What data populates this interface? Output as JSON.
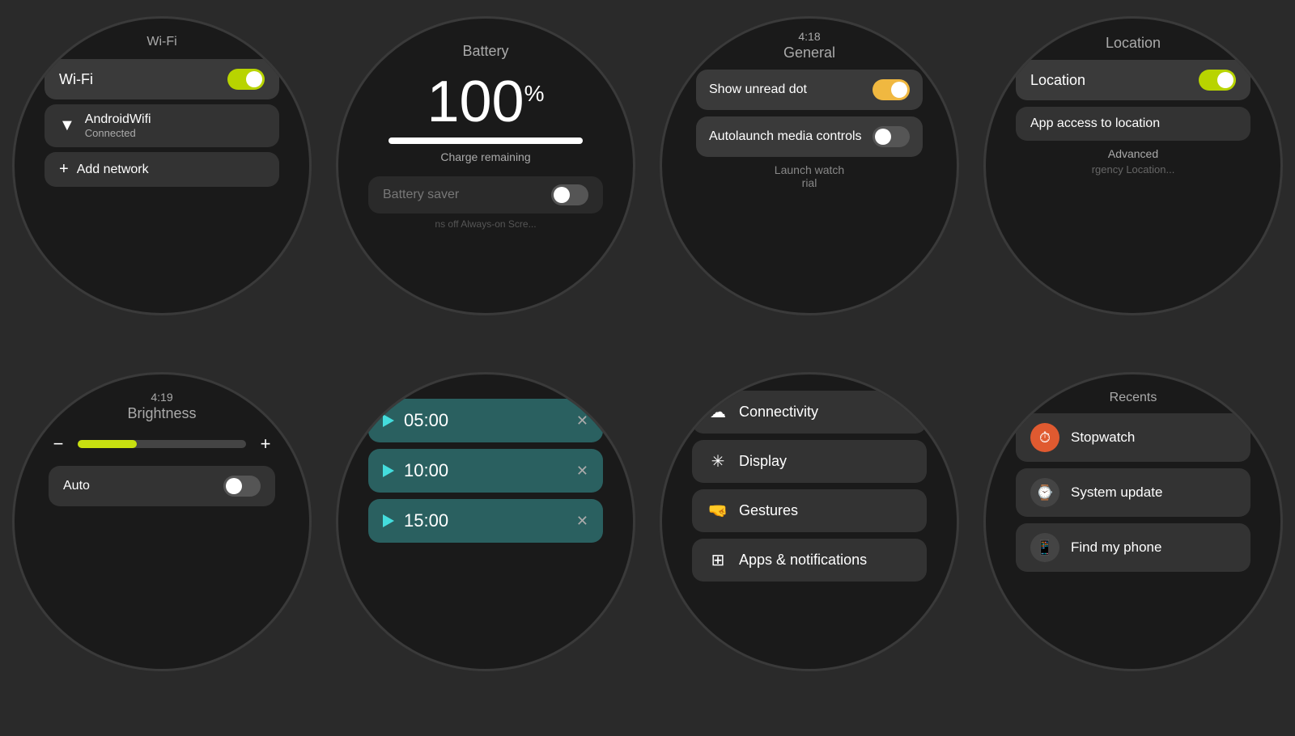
{
  "wifi": {
    "title": "Wi-Fi",
    "toggle_label": "Wi-Fi",
    "toggle_state": "on",
    "network_name": "AndroidWifi",
    "network_status": "Connected",
    "add_network": "Add network"
  },
  "battery": {
    "title": "Battery",
    "percent": "100",
    "percent_symbol": "%",
    "charge_text": "Charge remaining",
    "saver_label": "Battery saver",
    "always_on_text": "ns off Always-on Scre..."
  },
  "general": {
    "time": "4:18",
    "title": "General",
    "show_unread": "Show unread dot",
    "autolaunch": "Autolaunch media controls",
    "launch_watch": "Launch watch",
    "trial": "rial"
  },
  "location": {
    "title": "Location",
    "toggle_label": "Location",
    "app_access": "App access to location",
    "advanced": "Advanced",
    "emergency": "rgency Location..."
  },
  "brightness": {
    "time": "4:19",
    "title": "Brightness",
    "auto_label": "Auto",
    "fill_percent": 35
  },
  "timers": {
    "items": [
      {
        "time": "05:00"
      },
      {
        "time": "10:00"
      },
      {
        "time": "15:00"
      }
    ]
  },
  "settings": {
    "items": [
      {
        "icon": "cloud",
        "label": "Connectivity"
      },
      {
        "icon": "sun",
        "label": "Display"
      },
      {
        "icon": "gesture",
        "label": "Gestures"
      },
      {
        "icon": "apps",
        "label": "Apps & notifications"
      }
    ]
  },
  "recents": {
    "title": "Recents",
    "items": [
      {
        "label": "Stopwatch",
        "icon": "⏱",
        "color": "orange"
      },
      {
        "label": "System update",
        "icon": "⌚",
        "color": "dark"
      },
      {
        "label": "Find my phone",
        "icon": "📱",
        "color": "dark"
      }
    ]
  }
}
